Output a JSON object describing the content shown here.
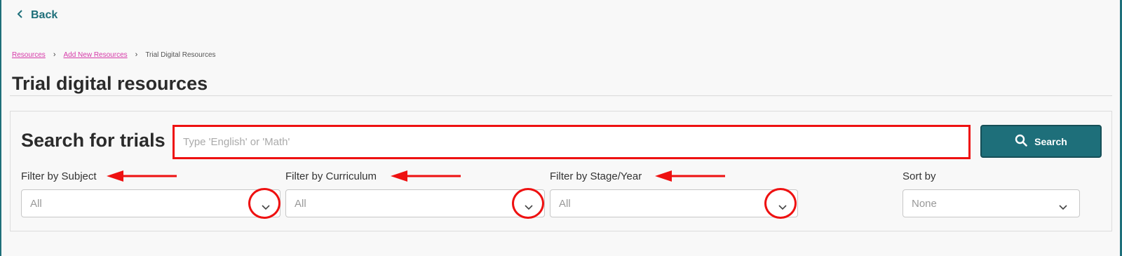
{
  "nav": {
    "back_label": "Back"
  },
  "breadcrumb": {
    "items": [
      {
        "label": "Resources",
        "link": true
      },
      {
        "label": "Add New Resources",
        "link": true
      },
      {
        "label": "Trial Digital Resources",
        "link": false
      }
    ],
    "separator": "›"
  },
  "page": {
    "title": "Trial digital resources"
  },
  "search": {
    "heading": "Search for trials",
    "placeholder": "Type 'English' or 'Math'",
    "button_label": "Search"
  },
  "filters": [
    {
      "label": "Filter by Subject",
      "value": "All"
    },
    {
      "label": "Filter by Curriculum",
      "value": "All"
    },
    {
      "label": "Filter by Stage/Year",
      "value": "All"
    },
    {
      "label": "Sort by",
      "value": "None"
    }
  ],
  "colors": {
    "accent": "#1e6f7a",
    "annotation": "#ee1111",
    "link": "#d63aa8"
  }
}
